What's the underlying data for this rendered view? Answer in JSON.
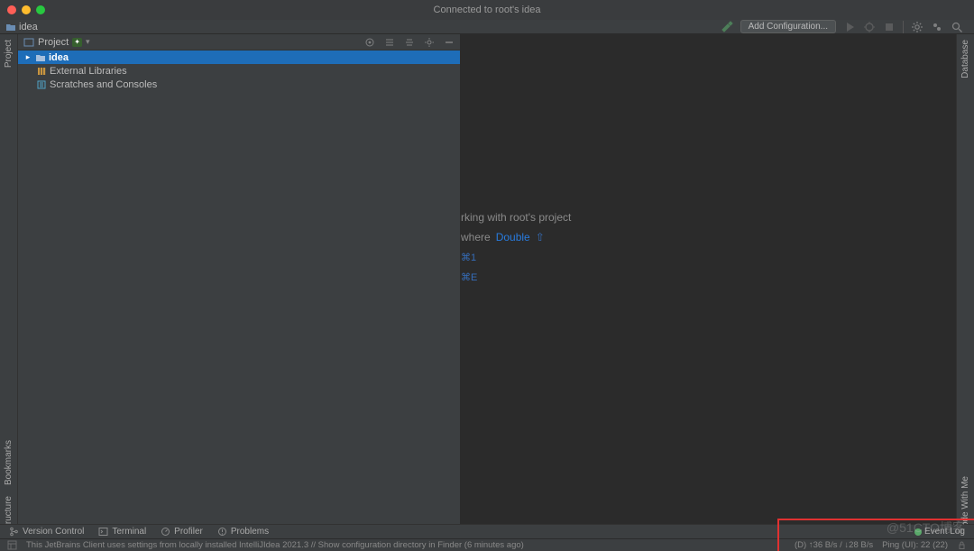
{
  "title": "Connected to root's idea",
  "breadcrumb": {
    "project": "idea"
  },
  "toolbar": {
    "add_configuration": "Add Configuration..."
  },
  "left_gutter": {
    "project": "Project",
    "bookmarks": "Bookmarks",
    "structure": "Structure"
  },
  "right_gutter": {
    "database": "Database",
    "code_with_me": "Code With Me"
  },
  "project_pane": {
    "title": "Project",
    "tree": {
      "root": "idea",
      "external_libs": "External Libraries",
      "scratches": "Scratches and Consoles"
    }
  },
  "editor_hints": {
    "row1_suffix": "rking with root's project",
    "row2_prefix": "where",
    "row2_link": "Double",
    "row2_key": "⇧",
    "row3_key": "⌘1",
    "row4_key": "⌘E"
  },
  "bottom_tools": {
    "version_control": "Version Control",
    "terminal": "Terminal",
    "profiler": "Profiler",
    "problems": "Problems",
    "event_log": "Event Log"
  },
  "status": {
    "message": "This JetBrains Client uses settings from locally installed IntelliJIdea 2021.3 // Show configuration directory in Finder (6 minutes ago)",
    "net": "(D) ↑36 B/s / ↓28 B/s",
    "ping": "Ping (UI): 22 (22)"
  },
  "watermark": "@51CTO博客"
}
